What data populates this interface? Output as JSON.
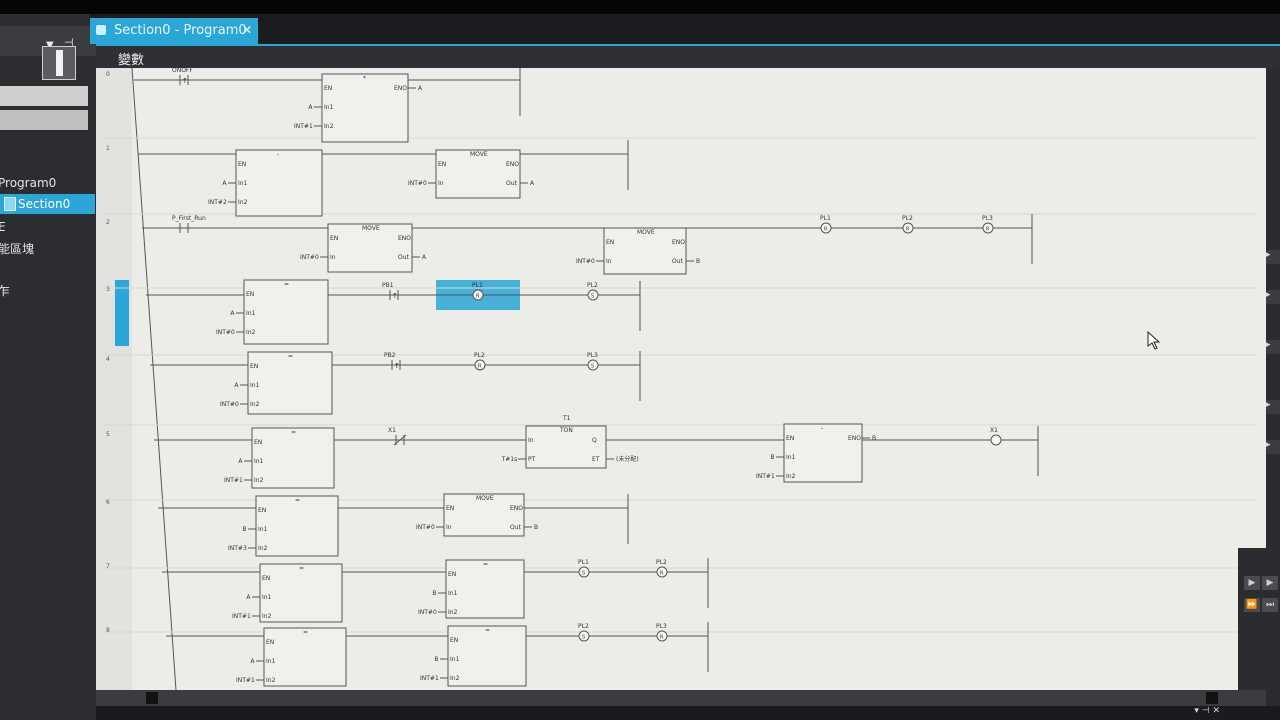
{
  "tab": {
    "title": "Section0 - Program0",
    "close": "✕"
  },
  "menubar": {
    "variables": "變數"
  },
  "left_panel": {
    "dropdown": "▼",
    "pin": "⊣",
    "tree": [
      {
        "label": "Program0"
      },
      {
        "label": "Section0"
      },
      {
        "label": "E"
      },
      {
        "label": "能區塊"
      },
      {
        "label": "乍"
      }
    ]
  },
  "status": {
    "icons": "▾ ⊣ ✕"
  },
  "ladder": {
    "rungs": [
      {
        "number": "0",
        "contacts": [
          {
            "label": "ONOFF",
            "type": "rising"
          }
        ],
        "blocks": [
          {
            "name": "*",
            "pins": [
              "EN",
              "In1",
              "In2"
            ],
            "outs": [
              "ENO"
            ],
            "args": [
              "A",
              "INT#1"
            ],
            "results": [
              "A"
            ]
          }
        ]
      },
      {
        "number": "1",
        "blocks": [
          {
            "name": "-",
            "pins": [
              "EN",
              "In1",
              "In2"
            ],
            "outs": [],
            "args": [
              "A",
              "INT#2"
            ],
            "results": []
          },
          {
            "name": "MOVE",
            "pins": [
              "EN",
              "In"
            ],
            "outs": [
              "ENO",
              "Out"
            ],
            "args": [
              "INT#0"
            ],
            "results": [
              "A"
            ]
          }
        ]
      },
      {
        "number": "2",
        "contacts": [
          {
            "label": "P_First_Run",
            "type": "no"
          }
        ],
        "blocks": [
          {
            "name": "MOVE",
            "pins": [
              "EN",
              "In"
            ],
            "outs": [
              "ENO",
              "Out"
            ],
            "args": [
              "INT#0"
            ],
            "results": [
              "A"
            ]
          },
          {
            "name": "MOVE",
            "pins": [
              "EN",
              "In"
            ],
            "outs": [
              "ENO",
              "Out"
            ],
            "args": [
              "INT#0"
            ],
            "results": [
              "B"
            ]
          }
        ],
        "coils": [
          {
            "label": "PL1",
            "mark": "R"
          },
          {
            "label": "PL2",
            "mark": "R"
          },
          {
            "label": "PL3",
            "mark": "R"
          }
        ]
      },
      {
        "number": "3",
        "blocks": [
          {
            "name": "=",
            "pins": [
              "EN",
              "In1",
              "In2"
            ],
            "outs": [],
            "args": [
              "A",
              "INT#0"
            ],
            "results": []
          }
        ],
        "contacts": [
          {
            "label": "PB1",
            "type": "rising"
          }
        ],
        "coils": [
          {
            "label": "PL1",
            "mark": "R"
          },
          {
            "label": "PL2",
            "mark": "S"
          }
        ]
      },
      {
        "number": "4",
        "blocks": [
          {
            "name": "=",
            "pins": [
              "EN",
              "In1",
              "In2"
            ],
            "outs": [],
            "args": [
              "A",
              "INT#0"
            ],
            "results": []
          }
        ],
        "contacts": [
          {
            "label": "PB2",
            "type": "rising"
          }
        ],
        "coils": [
          {
            "label": "PL2",
            "mark": "R"
          },
          {
            "label": "PL3",
            "mark": "S"
          }
        ]
      },
      {
        "number": "5",
        "blocks": [
          {
            "name": "=",
            "pins": [
              "EN",
              "In1",
              "In2"
            ],
            "outs": [],
            "args": [
              "A",
              "INT#1"
            ],
            "results": []
          },
          {
            "name": "TON",
            "instance": "T1",
            "pins": [
              "In",
              "PT"
            ],
            "outs": [
              "Q",
              "ET"
            ],
            "args": [
              "T#1s"
            ],
            "results": [
              "(未分配)"
            ]
          },
          {
            "name": "-",
            "pins": [
              "EN",
              "In1",
              "In2"
            ],
            "outs": [
              "ENO"
            ],
            "args": [
              "B",
              "INT#1"
            ],
            "results": [
              "B"
            ]
          }
        ],
        "contacts": [
          {
            "label": "X1",
            "type": "nc"
          }
        ],
        "coils": [
          {
            "label": "X1",
            "mark": ""
          }
        ]
      },
      {
        "number": "6",
        "blocks": [
          {
            "name": "=",
            "pins": [
              "EN",
              "In1",
              "In2"
            ],
            "outs": [],
            "args": [
              "B",
              "INT#3"
            ],
            "results": []
          },
          {
            "name": "MOVE",
            "pins": [
              "EN",
              "In"
            ],
            "outs": [
              "ENO",
              "Out"
            ],
            "args": [
              "INT#0"
            ],
            "results": [
              "B"
            ]
          }
        ]
      },
      {
        "number": "7",
        "blocks": [
          {
            "name": "=",
            "pins": [
              "EN",
              "In1",
              "In2"
            ],
            "outs": [],
            "args": [
              "A",
              "INT#1"
            ],
            "results": []
          },
          {
            "name": "=",
            "pins": [
              "EN",
              "In1",
              "In2"
            ],
            "outs": [],
            "args": [
              "B",
              "INT#0"
            ],
            "results": []
          }
        ],
        "coils": [
          {
            "label": "PL1",
            "mark": "S"
          },
          {
            "label": "PL2",
            "mark": "R"
          }
        ]
      },
      {
        "number": "8",
        "blocks": [
          {
            "name": "=",
            "pins": [
              "EN",
              "In1",
              "In2"
            ],
            "outs": [],
            "args": [
              "A",
              "INT#1"
            ],
            "results": []
          },
          {
            "name": "=",
            "pins": [
              "EN",
              "In1",
              "In2"
            ],
            "outs": [],
            "args": [
              "B",
              "INT#1"
            ],
            "results": []
          }
        ],
        "coils": [
          {
            "label": "PL2",
            "mark": "S"
          },
          {
            "label": "PL3",
            "mark": "R"
          }
        ]
      }
    ]
  },
  "colors": {
    "accent": "#2aa7d6",
    "canvas": "#ecece9",
    "line": "#555555",
    "dark": "#2b2d31"
  }
}
